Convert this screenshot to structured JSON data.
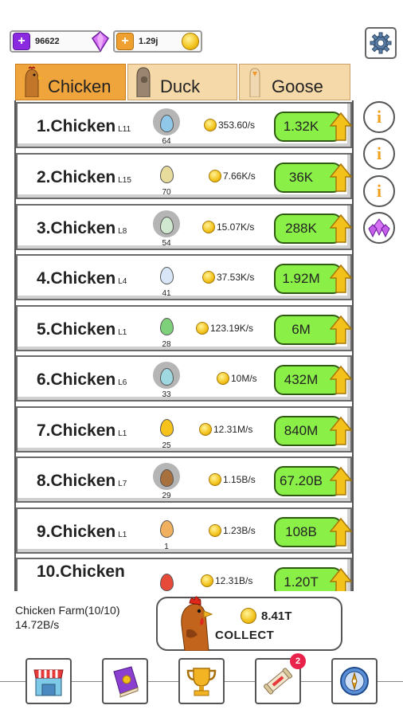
{
  "currencies": {
    "gems": {
      "value": "96622",
      "icon": "gem-icon"
    },
    "gold": {
      "value": "1.29j",
      "icon": "coin-icon"
    }
  },
  "tabs": [
    {
      "label": "Chicken",
      "active": true
    },
    {
      "label": "Duck",
      "active": false
    },
    {
      "label": "Goose",
      "active": false
    }
  ],
  "rows": [
    {
      "name": "1.Chicken",
      "level": "L11",
      "egg_count": "64",
      "rate": "353.60/s",
      "price": "1.32K",
      "egg_color": "#8fc8e8"
    },
    {
      "name": "2.Chicken",
      "level": "L15",
      "egg_count": "70",
      "rate": "7.66K/s",
      "price": "36K",
      "egg_color": "#e8dc9c"
    },
    {
      "name": "3.Chicken",
      "level": "L8",
      "egg_count": "54",
      "rate": "15.07K/s",
      "price": "288K",
      "egg_color": "#cfe8cf"
    },
    {
      "name": "4.Chicken",
      "level": "L4",
      "egg_count": "41",
      "rate": "37.53K/s",
      "price": "1.92M",
      "egg_color": "#d8e6f8"
    },
    {
      "name": "5.Chicken",
      "level": "L1",
      "egg_count": "28",
      "rate": "123.19K/s",
      "price": "6M",
      "egg_color": "#7ed07a"
    },
    {
      "name": "6.Chicken",
      "level": "L6",
      "egg_count": "33",
      "rate": "10M/s",
      "price": "432M",
      "egg_color": "#9fd8e0"
    },
    {
      "name": "7.Chicken",
      "level": "L1",
      "egg_count": "25",
      "rate": "12.31M/s",
      "price": "840M",
      "egg_color": "#f6c21c"
    },
    {
      "name": "8.Chicken",
      "level": "L7",
      "egg_count": "29",
      "rate": "1.15B/s",
      "price": "67.20B",
      "egg_color": "#a8703c"
    },
    {
      "name": "9.Chicken",
      "level": "L1",
      "egg_count": "1",
      "rate": "1.23B/s",
      "price": "108B",
      "egg_color": "#f0b060"
    },
    {
      "name": "10.Chicken",
      "level": "",
      "egg_count": "",
      "rate": "12.31B/s",
      "price": "1.20T",
      "egg_color": "#e84a3a"
    }
  ],
  "farm": {
    "name": "Chicken Farm(10/10)",
    "rate": "14.72B/s",
    "collect_amount": "8.41T",
    "collect_label": "COLLECT"
  },
  "nav": {
    "items": [
      {
        "name": "shop",
        "icon": "shop-icon"
      },
      {
        "name": "book",
        "icon": "book-icon"
      },
      {
        "name": "trophy",
        "icon": "trophy-icon"
      },
      {
        "name": "scroll",
        "icon": "scroll-icon",
        "badge": "2"
      },
      {
        "name": "compass",
        "icon": "compass-icon"
      }
    ]
  },
  "colors": {
    "tab_active": "#f0a43c",
    "tab_inactive": "#f5d9a8",
    "buy_button": "#8af048",
    "badge": "#e8224a"
  }
}
